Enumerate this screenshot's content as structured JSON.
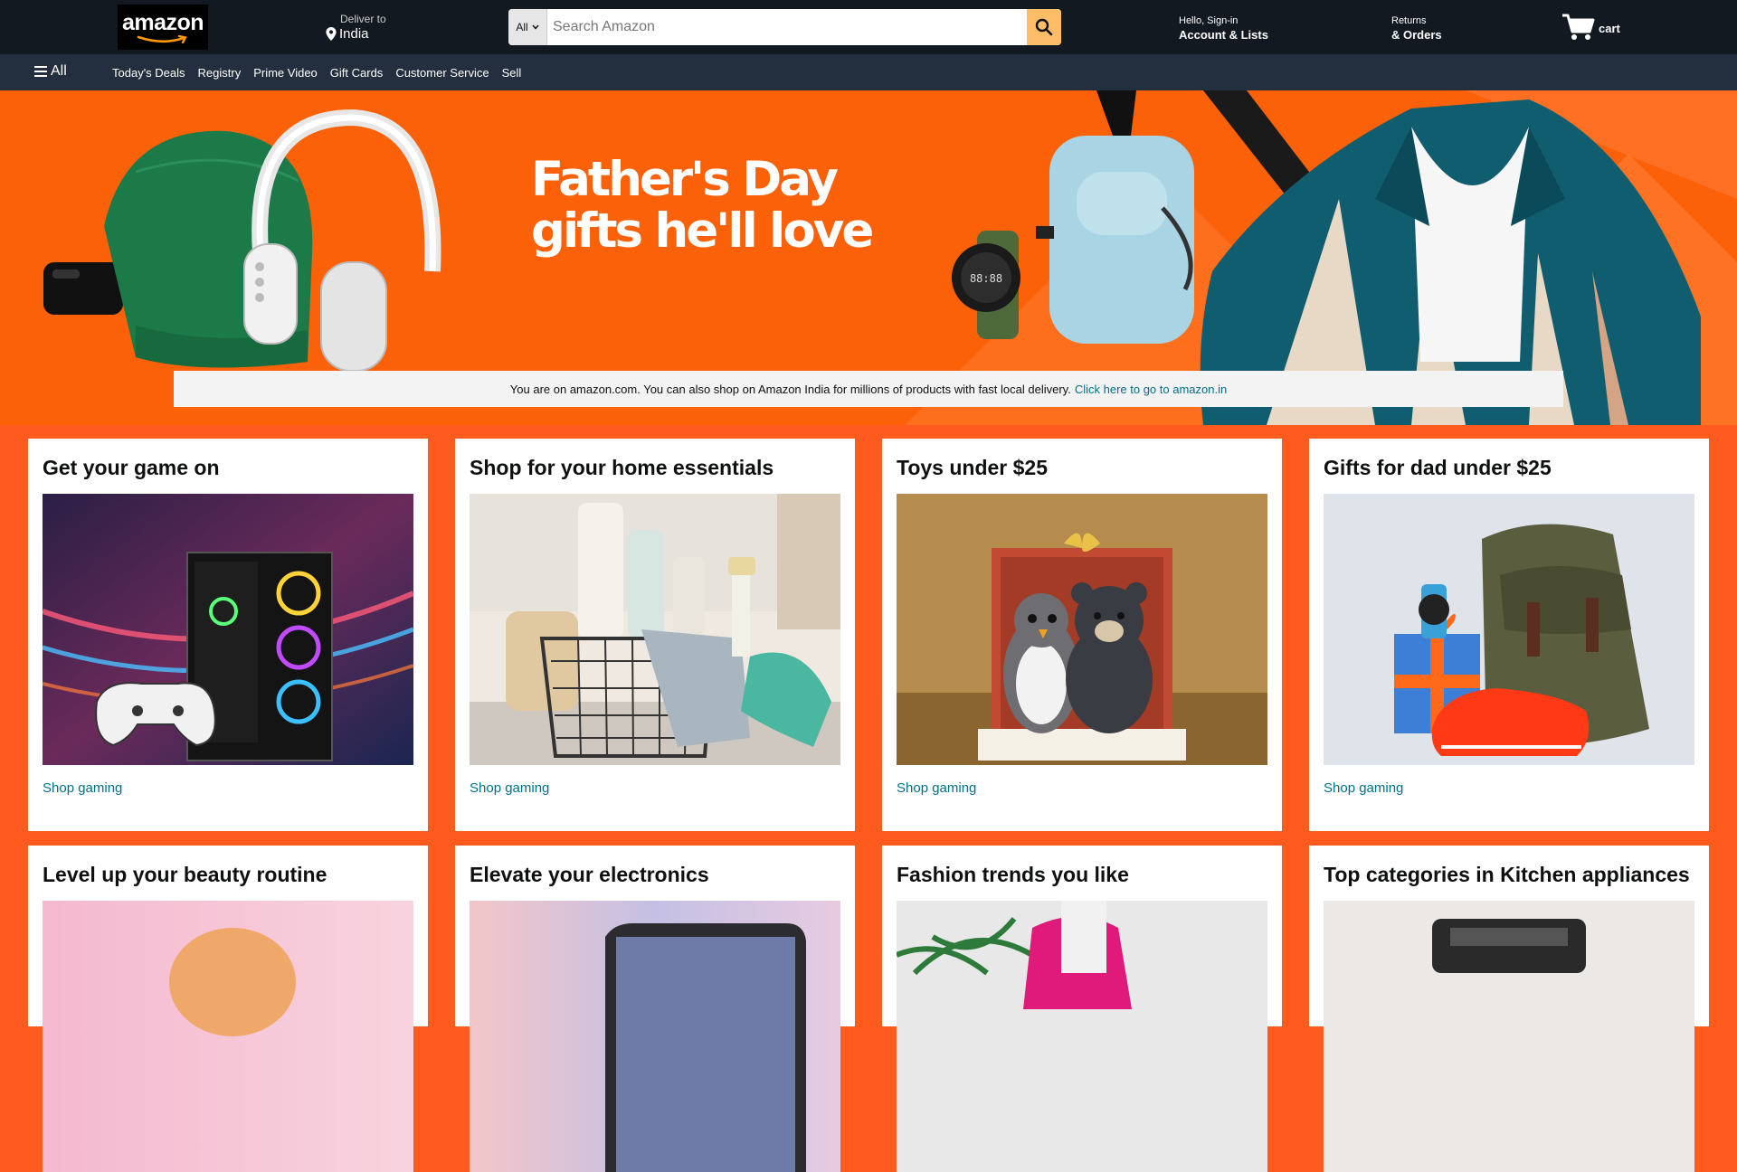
{
  "header": {
    "logo_text": "amazon",
    "deliver_label": "Deliver to",
    "deliver_location": "India",
    "search_category": "All",
    "search_placeholder": "Search Amazon",
    "account_line1": "Hello, Sign-in",
    "account_line2": "Account & Lists",
    "returns_line1": "Returns",
    "returns_line2": "& Orders",
    "cart_label": "cart"
  },
  "subnav": {
    "all_label": "All",
    "links": [
      "Today's Deals",
      "Registry",
      "Prime Video",
      "Gift Cards",
      "Customer Service",
      "Sell"
    ]
  },
  "hero": {
    "title_line1": "Father's Day",
    "title_line2": "gifts he'll love",
    "notice_text": "You are on amazon.com. You can also shop on Amazon India for millions of products with fast local delivery.",
    "notice_link": "Click here to go to amazon.in"
  },
  "cards": [
    {
      "title": "Get your game on",
      "link": "Shop gaming",
      "image": "gaming-pc-and-controller"
    },
    {
      "title": "Shop for your home essentials",
      "link": "Shop gaming",
      "image": "cleaning-supplies-basket"
    },
    {
      "title": "Toys under $25",
      "link": "Shop gaming",
      "image": "plush-penguin-and-bear"
    },
    {
      "title": "Gifts for dad under $25",
      "link": "Shop gaming",
      "image": "backpack-watch-sneaker"
    },
    {
      "title": "Level up your beauty routine",
      "image": "beauty-brush"
    },
    {
      "title": "Elevate your electronics",
      "image": "tablet"
    },
    {
      "title": "Fashion trends you like",
      "image": "pink-jacket"
    },
    {
      "title": "Top categories in Kitchen appliances",
      "image": "kitchen-appliance"
    }
  ],
  "colors": {
    "nav_dark": "#131921",
    "nav_secondary": "#232f3e",
    "search_button": "#febd69",
    "page_background": "#ff5b1f",
    "hero_orange": "#fb6109",
    "link": "#007185"
  }
}
